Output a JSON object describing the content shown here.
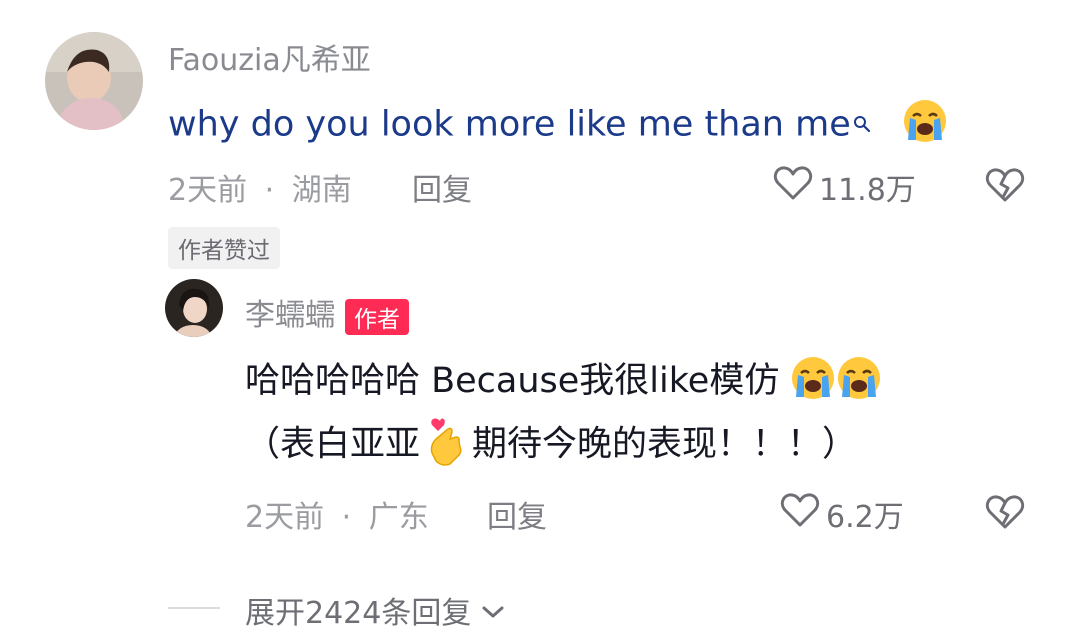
{
  "top_comment": {
    "username": "Faouzia凡希亚",
    "text": "why do you look more like me than me",
    "time": "2天前",
    "separator": "·",
    "location": "湖南",
    "reply_label": "回复",
    "likes": "11.8万",
    "author_liked_chip": "作者赞过",
    "colors": {
      "text": "#1b3a8a"
    }
  },
  "reply_comment": {
    "username": "李蠕蠕",
    "author_badge": "作者",
    "line1": "哈哈哈哈哈 Because我很like模仿",
    "line2_prefix": "（表白亚亚",
    "line2_suffix": "期待今晚的表现！！！）",
    "time": "2天前",
    "separator": "·",
    "location": "广东",
    "reply_label": "回复",
    "likes": "6.2万"
  },
  "expand": {
    "label": "展开2424条回复"
  },
  "icons": [
    "search-icon",
    "loudly-crying-face-icon",
    "heart-icon",
    "broken-heart-icon",
    "heart-hands-icon",
    "chevron-down-icon"
  ],
  "colors": {
    "accent": "#fe2c55",
    "muted": "#9b9ca1"
  }
}
